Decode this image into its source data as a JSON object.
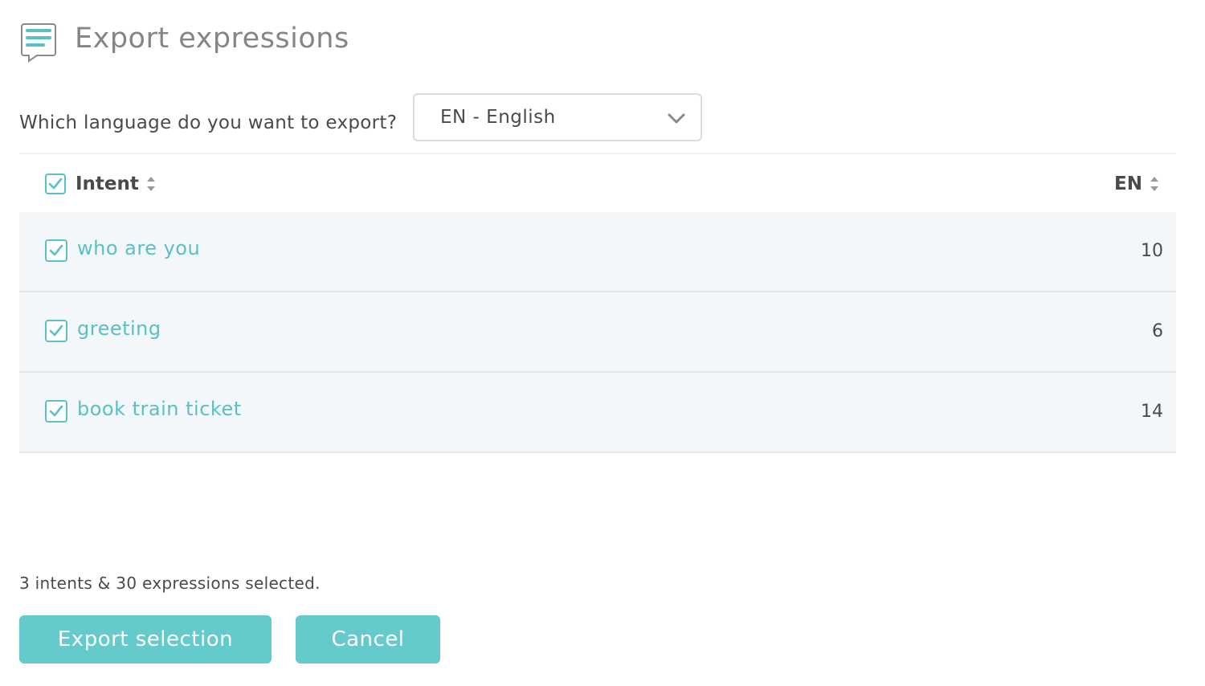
{
  "header": {
    "icon": "document-chat-icon",
    "title": "Export expressions"
  },
  "language": {
    "label": "Which language do you want to export?",
    "selected": "EN - English"
  },
  "table": {
    "columns": {
      "intent": "Intent",
      "count": "EN"
    },
    "rows": [
      {
        "name": "who are you",
        "count": "10",
        "checked": true
      },
      {
        "name": "greeting",
        "count": "6",
        "checked": true
      },
      {
        "name": "book train ticket",
        "count": "14",
        "checked": true
      }
    ]
  },
  "summary": "3 intents & 30 expressions selected.",
  "actions": {
    "export_label": "Export selection",
    "cancel_label": "Cancel"
  },
  "colors": {
    "accent": "#64cacc",
    "link": "#5bc0c6",
    "row_bg": "#f3f7fa"
  }
}
